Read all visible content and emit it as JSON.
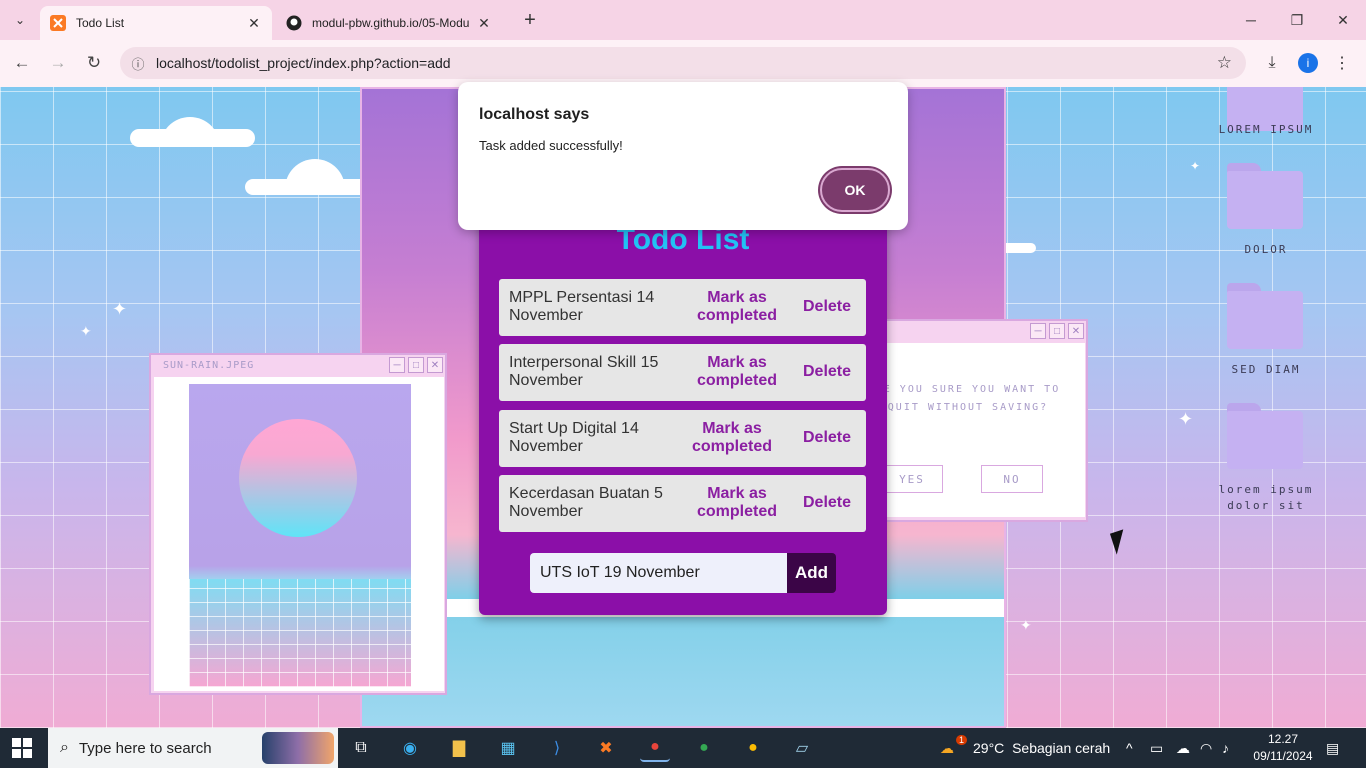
{
  "browser": {
    "tabs": [
      {
        "title": "Todo List",
        "active": true
      },
      {
        "title": "modul-pbw.github.io/05-Modu",
        "active": false
      }
    ],
    "url": "localhost/todolist_project/index.php?action=add"
  },
  "dialog": {
    "title": "localhost says",
    "message": "Task added successfully!",
    "ok_label": "OK"
  },
  "todo": {
    "title": "Todo List",
    "items": [
      {
        "text": "MPPL Persentasi 14 November",
        "mark": "Mark as completed",
        "delete": "Delete"
      },
      {
        "text": "Interpersonal Skill 15 November",
        "mark": "Mark as completed",
        "delete": "Delete"
      },
      {
        "text": "Start Up Digital 14 November",
        "mark": "Mark as completed",
        "delete": "Delete"
      },
      {
        "text": "Kecerdasan Buatan 5 November",
        "mark": "Mark as completed",
        "delete": "Delete"
      }
    ],
    "input_value": "UTS IoT 19 November",
    "add_label": "Add"
  },
  "desktop_windows": {
    "image_title": "SUN-RAIN.JPEG",
    "quit_message": "RE YOU SURE YOU WANT TO QUIT WITHOUT SAVING?",
    "yes_label": "YES",
    "no_label": "NO"
  },
  "folders": [
    "LOREM IPSUM",
    "DOLOR",
    "SED DIAM",
    "lorem ipsum dolor sit"
  ],
  "taskbar": {
    "search_placeholder": "Type here to search",
    "weather": "29°C  Sebagian cerah",
    "weather_badge": "1",
    "time": "12.27",
    "date": "09/11/2024"
  },
  "colors": {
    "accent": "#8b0fa8",
    "title": "#22c3f5",
    "dialog_ok": "#7b3b6c"
  }
}
